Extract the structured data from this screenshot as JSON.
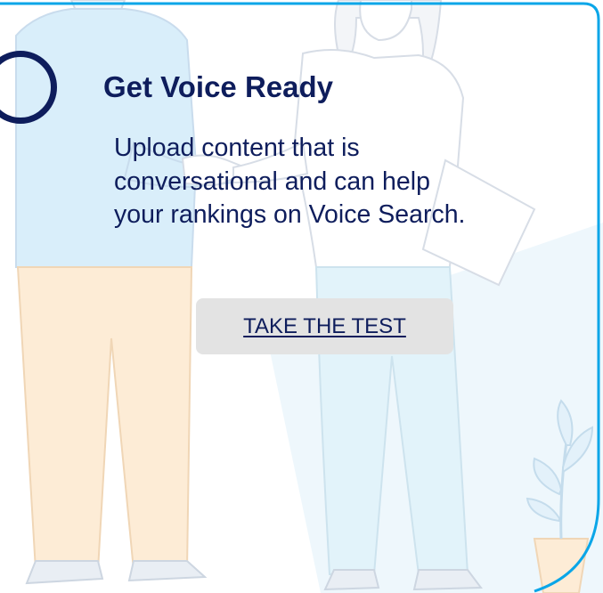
{
  "step": {
    "title": "Get Voice Ready",
    "description": "Upload content that is conversational and can help your rankings on Voice Search.",
    "cta_label": "TAKE THE TEST"
  },
  "colors": {
    "text": "#0e1d5c",
    "accent_border": "#0aa6e8",
    "button_bg": "#e3e3e3",
    "illustration_blue": "#d9eefa",
    "illustration_orange": "#fdecd6"
  }
}
